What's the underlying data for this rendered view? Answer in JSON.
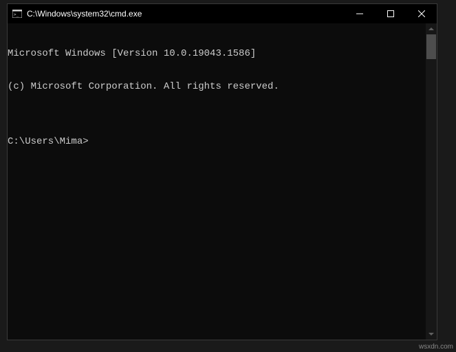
{
  "window": {
    "title": "C:\\Windows\\system32\\cmd.exe"
  },
  "terminal": {
    "line1": "Microsoft Windows [Version 10.0.19043.1586]",
    "line2": "(c) Microsoft Corporation. All rights reserved.",
    "blank": "",
    "prompt": "C:\\Users\\Mima>"
  },
  "watermark": "wsxdn.com"
}
